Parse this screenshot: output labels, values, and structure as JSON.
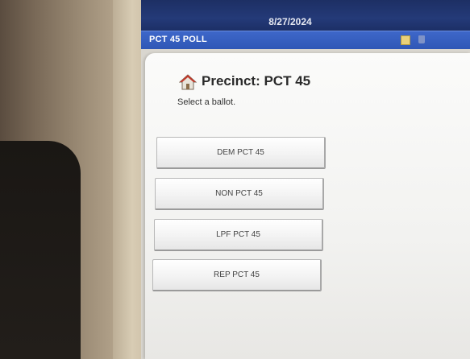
{
  "top_strip": {
    "date": "8/27/2024"
  },
  "window": {
    "title": "PCT 45 POLL",
    "icons": [
      "note-icon",
      "trash-icon"
    ]
  },
  "main": {
    "heading_icon": "house-icon",
    "heading": "Precinct: PCT 45",
    "instruction": "Select a ballot.",
    "ballots": [
      {
        "label": "DEM PCT 45"
      },
      {
        "label": "NON PCT 45"
      },
      {
        "label": "LPF PCT 45"
      },
      {
        "label": "REP PCT 45"
      }
    ]
  },
  "colors": {
    "title_bar": "#2f57b6",
    "top_strip": "#1d2f64",
    "panel": "#f5f5f3"
  }
}
